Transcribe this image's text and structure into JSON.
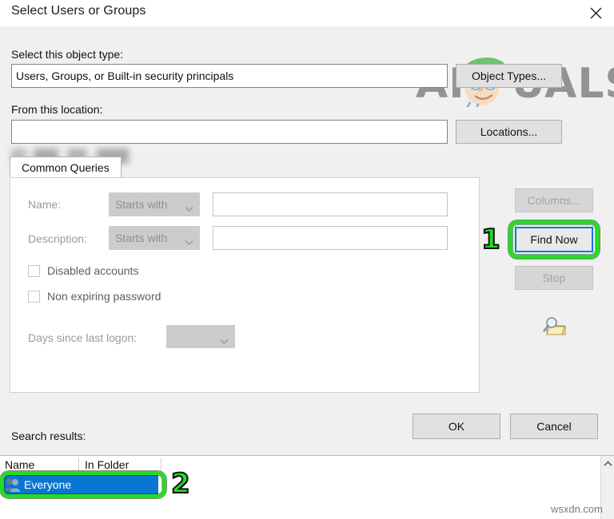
{
  "window": {
    "title": "Select Users or Groups",
    "close_icon": "close-icon"
  },
  "object_type": {
    "label": "Select this object type:",
    "value": "Users, Groups, or Built-in security principals",
    "button": "Object Types..."
  },
  "location": {
    "label": "From this location:",
    "value": "",
    "value_state": "redacted-blurred",
    "button": "Locations..."
  },
  "tabs": [
    {
      "label": "Common Queries",
      "selected": true
    }
  ],
  "query": {
    "name": {
      "label": "Name:",
      "operator": "Starts with",
      "value": "",
      "enabled": false
    },
    "description": {
      "label": "Description:",
      "operator": "Starts with",
      "value": "",
      "enabled": false
    },
    "checkboxes": [
      {
        "label": "Disabled accounts",
        "checked": false
      },
      {
        "label": "Non expiring password",
        "checked": false
      }
    ],
    "days_since_logon": {
      "label": "Days since last logon:",
      "value": "",
      "enabled": false
    }
  },
  "side_buttons": [
    {
      "label": "Columns...",
      "enabled": false,
      "focused": false
    },
    {
      "label": "Find Now",
      "enabled": true,
      "focused": true
    },
    {
      "label": "Stop",
      "enabled": false,
      "focused": false
    }
  ],
  "search_icon": "search-folder-icon",
  "dialog_buttons": {
    "ok": "OK",
    "cancel": "Cancel"
  },
  "results": {
    "label": "Search results:",
    "columns": [
      "Name",
      "In Folder"
    ],
    "rows": [
      {
        "name": "Everyone",
        "in_folder": "",
        "selected": true,
        "icon": "users-group-icon"
      }
    ],
    "scroll_up_icon": "chevron-up-icon"
  },
  "annotations": [
    {
      "number": "1",
      "targets": "Find Now"
    },
    {
      "number": "2",
      "targets": "Everyone result row"
    }
  ],
  "watermarks": {
    "brand": "APPUALS",
    "site": "wsxdn.com"
  },
  "colors": {
    "accent_focus": "#0078d7",
    "selection": "#0a76d4",
    "annotation": "#22dd22",
    "dialog_bg": "#f0f0f0",
    "button_bg": "#e1e1e1"
  }
}
